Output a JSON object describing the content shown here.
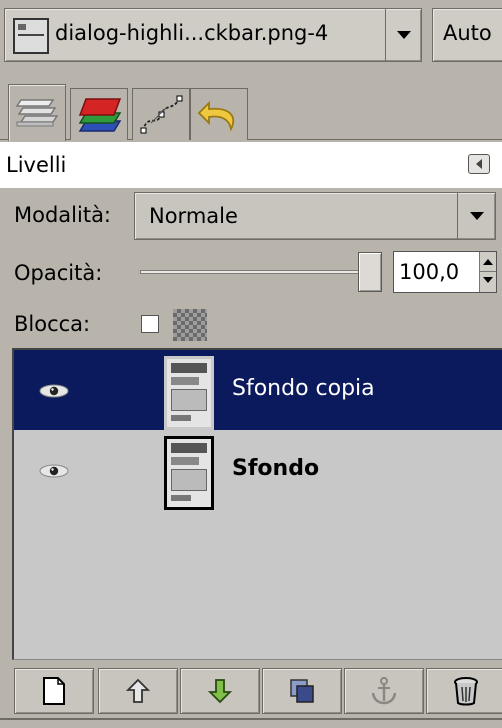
{
  "image_selector": {
    "selected_image": "dialog-highli...ckbar.png-4",
    "auto_button": "Auto"
  },
  "tabs": [
    {
      "name": "layers",
      "icon": "layers-icon",
      "active": true
    },
    {
      "name": "channels",
      "icon": "channels-icon",
      "active": false
    },
    {
      "name": "paths",
      "icon": "paths-icon",
      "active": false
    },
    {
      "name": "undo",
      "icon": "undo-icon",
      "active": false
    }
  ],
  "panel": {
    "title": "Livelli"
  },
  "mode": {
    "label": "Modalità:",
    "value": "Normale"
  },
  "opacity": {
    "label": "Opacità:",
    "value": "100,0",
    "level": 100
  },
  "lock": {
    "label": "Blocca:",
    "checked": false
  },
  "layers": [
    {
      "name": "Sfondo copia",
      "visible": true,
      "selected": true
    },
    {
      "name": "Sfondo",
      "visible": true,
      "selected": false
    }
  ],
  "toolbar": [
    {
      "name": "new-layer",
      "icon": "new-layer-icon"
    },
    {
      "name": "raise-layer",
      "icon": "raise-layer-icon"
    },
    {
      "name": "lower-layer",
      "icon": "lower-layer-icon"
    },
    {
      "name": "duplicate-layer",
      "icon": "duplicate-layer-icon"
    },
    {
      "name": "anchor-layer",
      "icon": "anchor-icon"
    },
    {
      "name": "delete-layer",
      "icon": "trash-icon"
    }
  ],
  "colors": {
    "selection": "#0b1a5c",
    "panel_bg": "#b8b4ac",
    "list_bg": "#c8c8c8"
  }
}
